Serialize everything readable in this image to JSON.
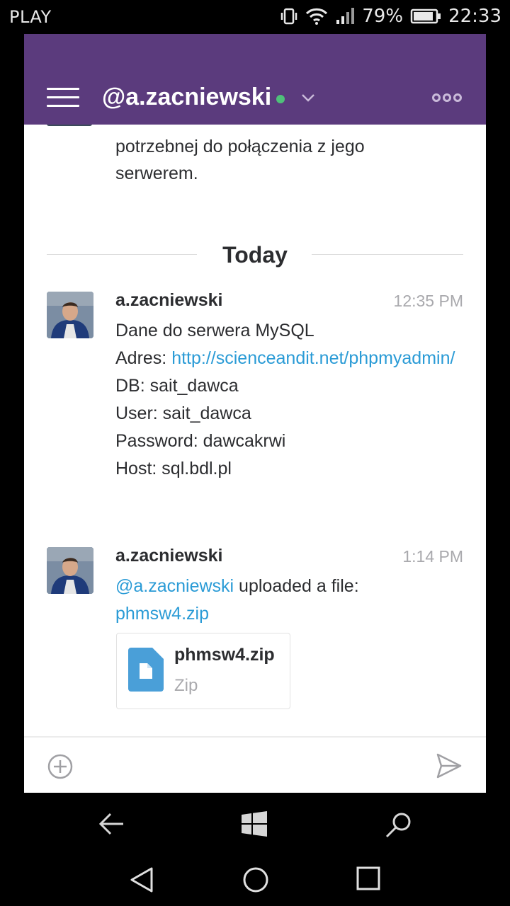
{
  "status_bar": {
    "carrier": "PLAY",
    "battery": "79%",
    "time": "22:33"
  },
  "header": {
    "channel": "@a.zacniewski",
    "presence_color": "#4fc07a",
    "accent_color": "#5b3b7d"
  },
  "previous_message": {
    "text": "potrzebnej do połączenia z jego serwerem."
  },
  "day_divider": "Today",
  "messages": [
    {
      "user": "a.zacniewski",
      "time": "12:35 PM",
      "lines": {
        "l1": "Dane do serwera MySQL",
        "adres_label": "Adres: ",
        "adres_link": "http://scienceandit.net/phpmyadmin/",
        "db": "DB: sait_dawca",
        "user": "User: sait_dawca",
        "password": "Password: dawcakrwi",
        "host": "Host: sql.bdl.pl"
      }
    },
    {
      "user": "a.zacniewski",
      "time": "1:14 PM",
      "mention": "@a.zacniewski",
      "action": " uploaded a file:",
      "file_link": "phmsw4.zip",
      "file": {
        "name": "phmsw4.zip",
        "type": "Zip",
        "icon": "document-icon",
        "icon_color": "#4a9fd8"
      }
    }
  ],
  "link_color": "#2a9bd6"
}
